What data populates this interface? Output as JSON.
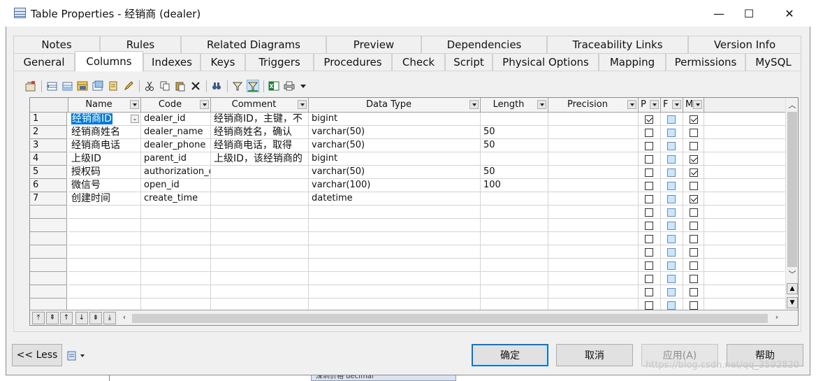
{
  "window": {
    "title": "Table Properties - 经销商 (dealer)",
    "minimize": "—",
    "maximize": "☐",
    "close": "✕"
  },
  "tabs_row1": [
    "Notes",
    "Rules",
    "Related Diagrams",
    "Preview",
    "Dependencies",
    "Traceability Links",
    "Version Info"
  ],
  "tabs_row2": [
    "General",
    "Columns",
    "Indexes",
    "Keys",
    "Triggers",
    "Procedures",
    "Check",
    "Script",
    "Physical Options",
    "Mapping",
    "Permissions",
    "MySQL"
  ],
  "active_tab": "Columns",
  "columns": {
    "name": "Name",
    "code": "Code",
    "comment": "Comment",
    "data_type": "Data Type",
    "length": "Length",
    "precision": "Precision",
    "p": "P",
    "f": "F",
    "m": "M"
  },
  "rows": [
    {
      "num": "1",
      "name": "经销商ID",
      "code": "dealer_id",
      "comment": "经销商ID，主键，不",
      "data_type": "bigint",
      "length": "",
      "precision": "",
      "p": true,
      "m": true
    },
    {
      "num": "2",
      "name": "经销商姓名",
      "code": "dealer_name",
      "comment": "经销商姓名，确认",
      "data_type": "varchar(50)",
      "length": "50",
      "precision": "",
      "p": false,
      "m": false
    },
    {
      "num": "3",
      "name": "经销商电话",
      "code": "dealer_phone",
      "comment": "经销商电话，取得",
      "data_type": "varchar(50)",
      "length": "50",
      "precision": "",
      "p": false,
      "m": false
    },
    {
      "num": "4",
      "name": "上级ID",
      "code": "parent_id",
      "comment": "上级ID，该经销商的",
      "data_type": "bigint",
      "length": "",
      "precision": "",
      "p": false,
      "m": true
    },
    {
      "num": "5",
      "name": "授权码",
      "code": "authorization_c",
      "comment": "",
      "data_type": "varchar(50)",
      "length": "50",
      "precision": "",
      "p": false,
      "m": true
    },
    {
      "num": "6",
      "name": "微信号",
      "code": "open_id",
      "comment": "",
      "data_type": "varchar(100)",
      "length": "100",
      "precision": "",
      "p": false,
      "m": false
    },
    {
      "num": "7",
      "name": "创建时间",
      "code": "create_time",
      "comment": "",
      "data_type": "datetime",
      "length": "",
      "precision": "",
      "p": false,
      "m": true
    }
  ],
  "empty_rows": 8,
  "buttons": {
    "less": "<< Less",
    "ok": "确定",
    "cancel": "取消",
    "apply": "应用(A)",
    "help": "帮助"
  },
  "watermark": "https://blog.csdn.net/qq_3592820",
  "background_cell": "深圳价格      decimal",
  "colors": {
    "selection": "#0078d7",
    "primary_border": "#0078d7",
    "f_checkbox": "#cfe6f8"
  }
}
